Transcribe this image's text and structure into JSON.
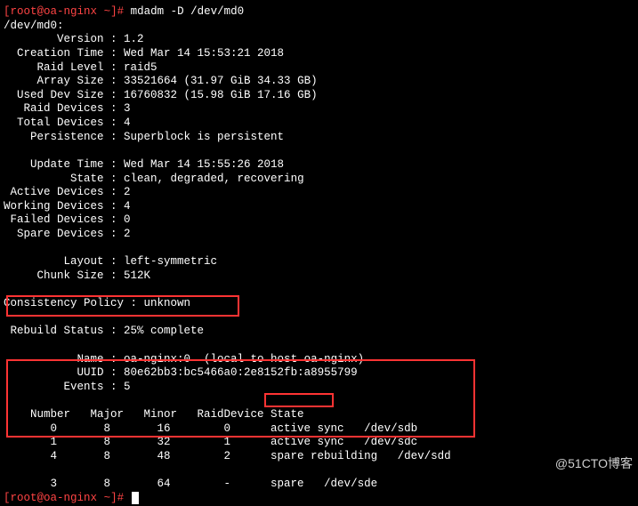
{
  "prompt1": {
    "open_bracket": "[",
    "user": "root",
    "at": "@",
    "host": "oa-nginx",
    "tilde": " ~",
    "close_bracket": "]#",
    "cmd": " mdadm -D /dev/md0"
  },
  "device_line": "/dev/md0:",
  "fields": [
    {
      "label": "        Version :",
      "value": " 1.2"
    },
    {
      "label": "  Creation Time :",
      "value": " Wed Mar 14 15:53:21 2018"
    },
    {
      "label": "     Raid Level :",
      "value": " raid5"
    },
    {
      "label": "     Array Size :",
      "value": " 33521664 (31.97 GiB 34.33 GB)"
    },
    {
      "label": "  Used Dev Size :",
      "value": " 16760832 (15.98 GiB 17.16 GB)"
    },
    {
      "label": "   Raid Devices :",
      "value": " 3"
    },
    {
      "label": "  Total Devices :",
      "value": " 4"
    },
    {
      "label": "    Persistence :",
      "value": " Superblock is persistent"
    }
  ],
  "fields2": [
    {
      "label": "    Update Time :",
      "value": " Wed Mar 14 15:55:26 2018"
    },
    {
      "label": "          State :",
      "value": " clean, degraded, recovering"
    },
    {
      "label": " Active Devices :",
      "value": " 2"
    },
    {
      "label": "Working Devices :",
      "value": " 4"
    },
    {
      "label": " Failed Devices :",
      "value": " 0"
    },
    {
      "label": "  Spare Devices :",
      "value": " 2"
    }
  ],
  "fields3": [
    {
      "label": "         Layout :",
      "value": " left-symmetric"
    },
    {
      "label": "     Chunk Size :",
      "value": " 512K"
    }
  ],
  "consistency": {
    "label": "Consistency Policy :",
    "value": " unknown"
  },
  "rebuild": {
    "label": " Rebuild Status :",
    "value": " 25% complete"
  },
  "fields4": [
    {
      "label": "           Name :",
      "value": " oa-nginx:0  (local to host oa-nginx)"
    },
    {
      "label": "           UUID :",
      "value": " 80e62bb3:bc5466a0:2e8152fb:a8955799"
    },
    {
      "label": "         Events :",
      "value": " 5"
    }
  ],
  "table_header": "    Number   Major   Minor   RaidDevice State",
  "table_rows": [
    "       0       8       16        0      active sync   /dev/sdb",
    "       1       8       32        1      active sync   /dev/sdc",
    "       4       8       48        2      spare rebuilding   /dev/sdd"
  ],
  "spare_row": "       3       8       64        -      spare   /dev/sde",
  "prompt2": {
    "open_bracket": "[",
    "user": "root",
    "at": "@",
    "host": "oa-nginx",
    "tilde": " ~",
    "close_bracket": "]#",
    "cmd": " "
  },
  "watermark": "@51CTO博客"
}
